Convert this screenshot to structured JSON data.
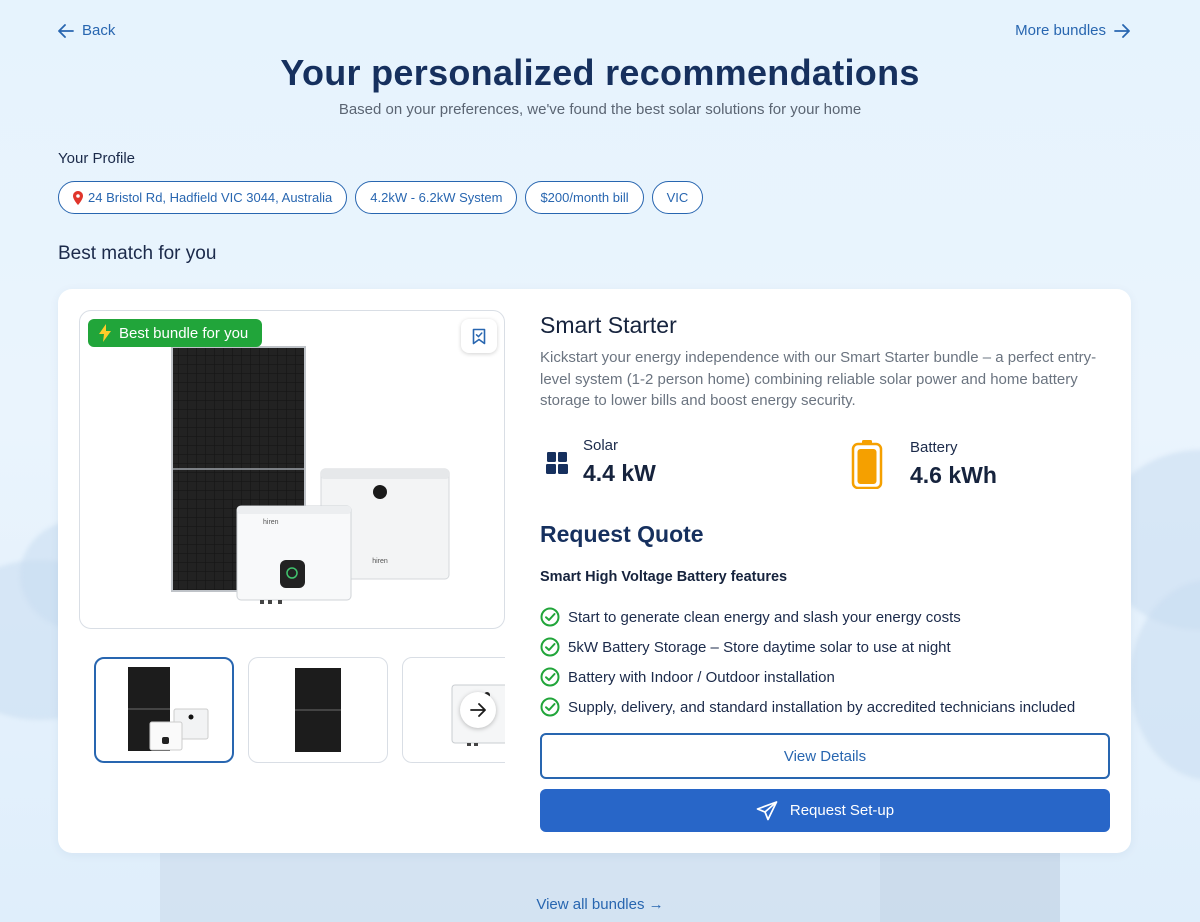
{
  "nav": {
    "back_label": "Back",
    "more_label": "More bundles"
  },
  "hero": {
    "title": "Your personalized recommendations",
    "subtitle": "Based on your preferences, we've found the best solar solutions for your home"
  },
  "profile": {
    "label": "Your Profile",
    "chips": [
      "24 Bristol Rd, Hadfield VIC 3044, Australia",
      "4.2kW - 6.2kW System",
      "$200/month bill",
      "VIC"
    ]
  },
  "best_match_label": "Best match for you",
  "bundle": {
    "badge": "Best bundle for you",
    "name": "Smart Starter",
    "description": "Kickstart your energy independence with our Smart Starter bundle – a perfect entry-level system (1-2 person home) combining reliable solar power and home battery storage to lower bills and boost energy security.",
    "specs": {
      "solar_label": "Solar",
      "solar_value": "4.4 kW",
      "battery_label": "Battery",
      "battery_value": "4.6 kWh"
    },
    "request_quote": "Request Quote",
    "features_title": "Smart High Voltage Battery features",
    "features": [
      "Start to generate clean energy and slash your energy costs",
      "5kW Battery Storage – Store daytime solar to use at night",
      "Battery with Indoor / Outdoor installation",
      "Supply, delivery, and standard installation by accredited technicians included"
    ],
    "view_details": "View Details",
    "request_setup": "Request Set-up",
    "brand_text": "hiren"
  },
  "view_all": "View all bundles →",
  "colors": {
    "primary": "#2866b0",
    "badge_green": "#21a53a",
    "battery_orange": "#f5a000"
  }
}
